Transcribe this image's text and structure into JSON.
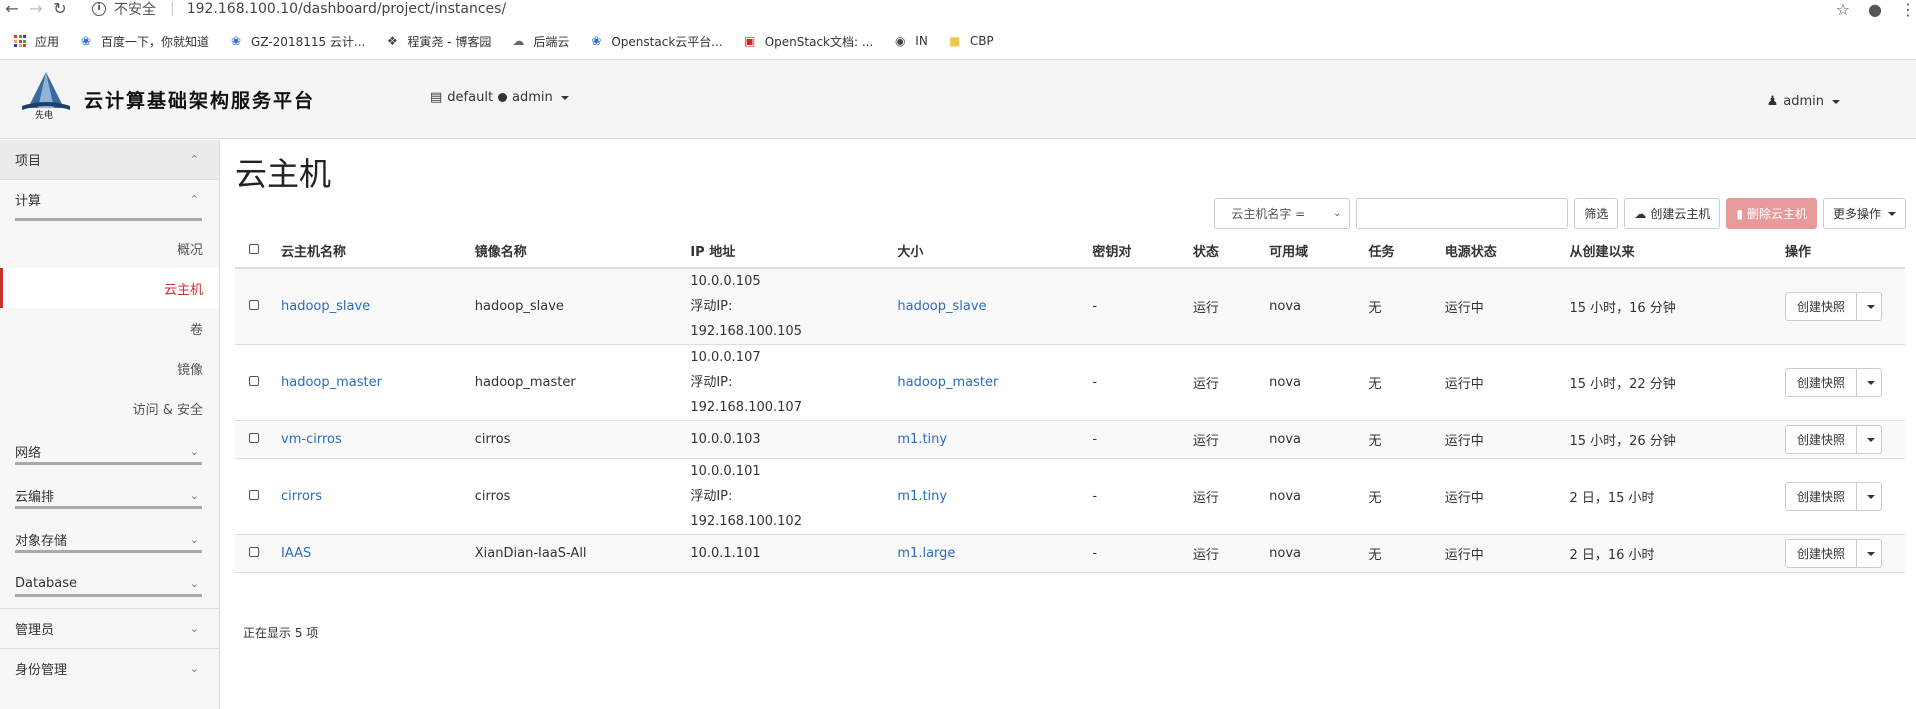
{
  "browser": {
    "insecure_label": "不安全",
    "url": "192.168.100.10/dashboard/project/instances/",
    "bookmarks": [
      {
        "label": "应用",
        "icon": "apps-grid-icon"
      },
      {
        "label": "百度一下，你就知道",
        "icon": "baidu-paw-icon"
      },
      {
        "label": "GZ-2018115 云计...",
        "icon": "baidu-paw-icon"
      },
      {
        "label": "程寅尧 - 博客园",
        "icon": "cnblogs-icon"
      },
      {
        "label": "后端云",
        "icon": "cloud-icon"
      },
      {
        "label": "Openstack云平台...",
        "icon": "baidu-paw-icon"
      },
      {
        "label": "OpenStack文档: ...",
        "icon": "openstack-icon"
      },
      {
        "label": "IN",
        "icon": "globe-icon"
      },
      {
        "label": "CBP",
        "icon": "folder-icon"
      }
    ]
  },
  "header": {
    "brand": "云计算基础架构服务平台",
    "logo_text": "先电",
    "domain": "default",
    "project": "admin",
    "user": "admin"
  },
  "sidebar": {
    "project": "项目",
    "compute": "计算",
    "items": [
      {
        "label": "概况",
        "active": false
      },
      {
        "label": "云主机",
        "active": true
      },
      {
        "label": "卷",
        "active": false
      },
      {
        "label": "镜像",
        "active": false
      },
      {
        "label": "访问 & 安全",
        "active": false
      }
    ],
    "groups": [
      "网络",
      "云编排",
      "对象存储",
      "Database"
    ],
    "admin": "管理员",
    "identity": "身份管理"
  },
  "page": {
    "title": "云主机",
    "filter_select": "云主机名字 =",
    "filter_btn": "筛选",
    "create_btn": "创建云主机",
    "delete_btn": "删除云主机",
    "more_btn": "更多操作"
  },
  "table": {
    "headers": [
      "云主机名称",
      "镜像名称",
      "IP 地址",
      "大小",
      "密钥对",
      "状态",
      "可用域",
      "任务",
      "电源状态",
      "从创建以来",
      "操作"
    ],
    "rows": [
      {
        "name": "hadoop_slave",
        "image": "hadoop_slave",
        "ip": [
          "10.0.0.105",
          "浮动IP:",
          "192.168.100.105"
        ],
        "size": "hadoop_slave",
        "key": "-",
        "status": "运行",
        "zone": "nova",
        "task": "无",
        "power": "运行中",
        "age": "15 小时，16 分钟",
        "action": "创建快照"
      },
      {
        "name": "hadoop_master",
        "image": "hadoop_master",
        "ip": [
          "10.0.0.107",
          "浮动IP:",
          "192.168.100.107"
        ],
        "size": "hadoop_master",
        "key": "-",
        "status": "运行",
        "zone": "nova",
        "task": "无",
        "power": "运行中",
        "age": "15 小时，22 分钟",
        "action": "创建快照"
      },
      {
        "name": "vm-cirros",
        "image": "cirros",
        "ip": [
          "10.0.0.103"
        ],
        "size": "m1.tiny",
        "key": "-",
        "status": "运行",
        "zone": "nova",
        "task": "无",
        "power": "运行中",
        "age": "15 小时，26 分钟",
        "action": "创建快照"
      },
      {
        "name": "cirrors",
        "image": "cirros",
        "ip": [
          "10.0.0.101",
          "浮动IP:",
          "192.168.100.102"
        ],
        "size": "m1.tiny",
        "key": "-",
        "status": "运行",
        "zone": "nova",
        "task": "无",
        "power": "运行中",
        "age": "2 日，15 小时",
        "action": "创建快照"
      },
      {
        "name": "IAAS",
        "image": "XianDian-IaaS-All",
        "ip": [
          "10.0.1.101"
        ],
        "size": "m1.large",
        "key": "-",
        "status": "运行",
        "zone": "nova",
        "task": "无",
        "power": "运行中",
        "age": "2 日，16 小时",
        "action": "创建快照"
      }
    ],
    "footer": "正在显示 5 项"
  }
}
